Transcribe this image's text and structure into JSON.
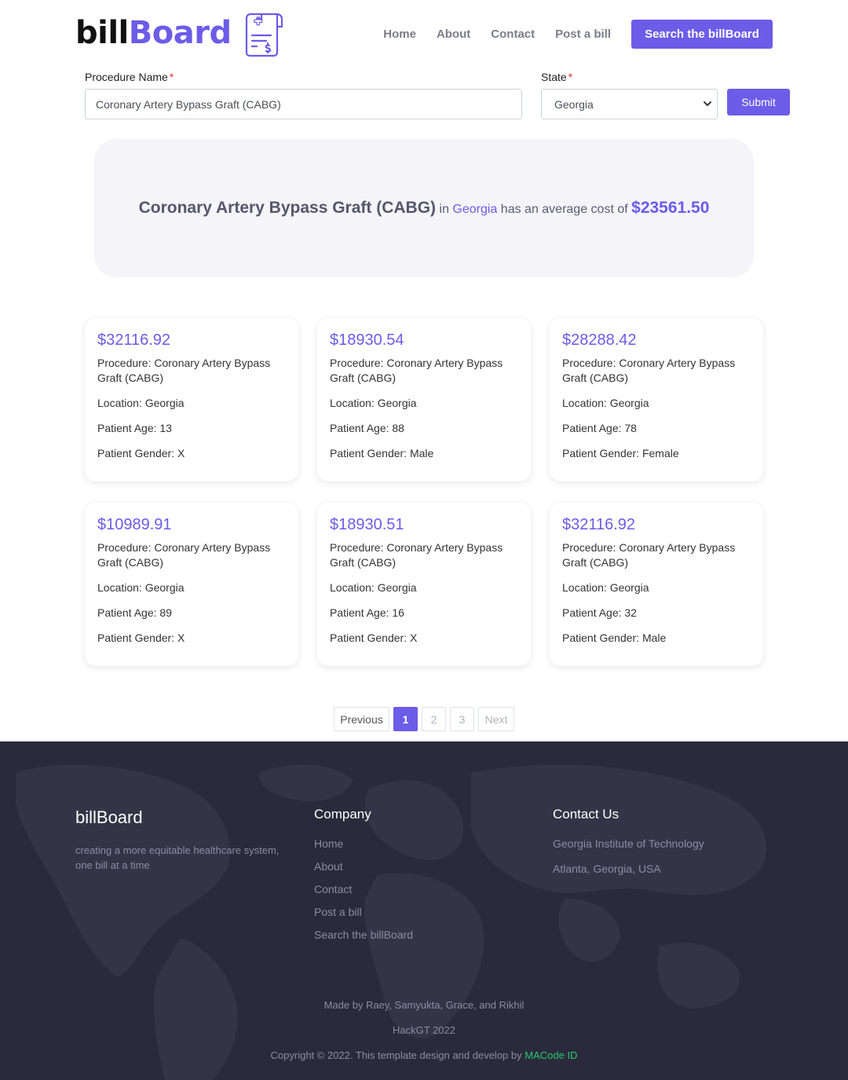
{
  "header": {
    "logo_part1": "bill",
    "logo_part2": "Board",
    "nav": [
      "Home",
      "About",
      "Contact",
      "Post a bill"
    ],
    "cta": "Search the billBoard"
  },
  "form": {
    "procedure_label": "Procedure Name",
    "procedure_value": "Coronary Artery Bypass Graft (CABG)",
    "state_label": "State",
    "state_value": "Georgia",
    "required_mark": "*",
    "submit": "Submit"
  },
  "summary": {
    "procedure": "Coronary Artery Bypass Graft (CABG)",
    "in_word": "in",
    "state": "Georgia",
    "phrase": "has an average cost of",
    "average_cost": "$23561.50"
  },
  "cards": [
    {
      "price": "$32116.92",
      "procedure": "Procedure: Coronary Artery Bypass Graft (CABG)",
      "location": "Location: Georgia",
      "age": "Patient Age: 13",
      "gender": "Patient Gender: X"
    },
    {
      "price": "$18930.54",
      "procedure": "Procedure: Coronary Artery Bypass Graft (CABG)",
      "location": "Location: Georgia",
      "age": "Patient Age: 88",
      "gender": "Patient Gender: Male"
    },
    {
      "price": "$28288.42",
      "procedure": "Procedure: Coronary Artery Bypass Graft (CABG)",
      "location": "Location: Georgia",
      "age": "Patient Age: 78",
      "gender": "Patient Gender: Female"
    },
    {
      "price": "$10989.91",
      "procedure": "Procedure: Coronary Artery Bypass Graft (CABG)",
      "location": "Location: Georgia",
      "age": "Patient Age: 89",
      "gender": "Patient Gender: X"
    },
    {
      "price": "$18930.51",
      "procedure": "Procedure: Coronary Artery Bypass Graft (CABG)",
      "location": "Location: Georgia",
      "age": "Patient Age: 16",
      "gender": "Patient Gender: X"
    },
    {
      "price": "$32116.92",
      "procedure": "Procedure: Coronary Artery Bypass Graft (CABG)",
      "location": "Location: Georgia",
      "age": "Patient Age: 32",
      "gender": "Patient Gender: Male"
    }
  ],
  "pagination": {
    "previous": "Previous",
    "pages": [
      "1",
      "2",
      "3"
    ],
    "active_page": "1",
    "next": "Next"
  },
  "footer": {
    "brand": "billBoard",
    "tagline": "creating a more equitable healthcare system, one bill at a time",
    "company_heading": "Company",
    "company_links": [
      "Home",
      "About",
      "Contact",
      "Post a bill",
      "Search the billBoard"
    ],
    "contact_heading": "Contact Us",
    "contact_lines": [
      "Georgia Institute of Technology",
      "Atlanta, Georgia, USA"
    ],
    "made_by": "Made by Raey, Samyukta, Grace, and Rikhil",
    "event": "HackGT 2022",
    "copyright": "Copyright © 2022. This template design and develop by",
    "credit_link": "MACode ID"
  },
  "colors": {
    "accent": "#6c5ce7",
    "footer_bg": "#2b2a3c",
    "credit_link": "#27c96e"
  },
  "icons": [
    "bill-document-icon",
    "chevron-down-icon",
    "world-map-graphic"
  ]
}
